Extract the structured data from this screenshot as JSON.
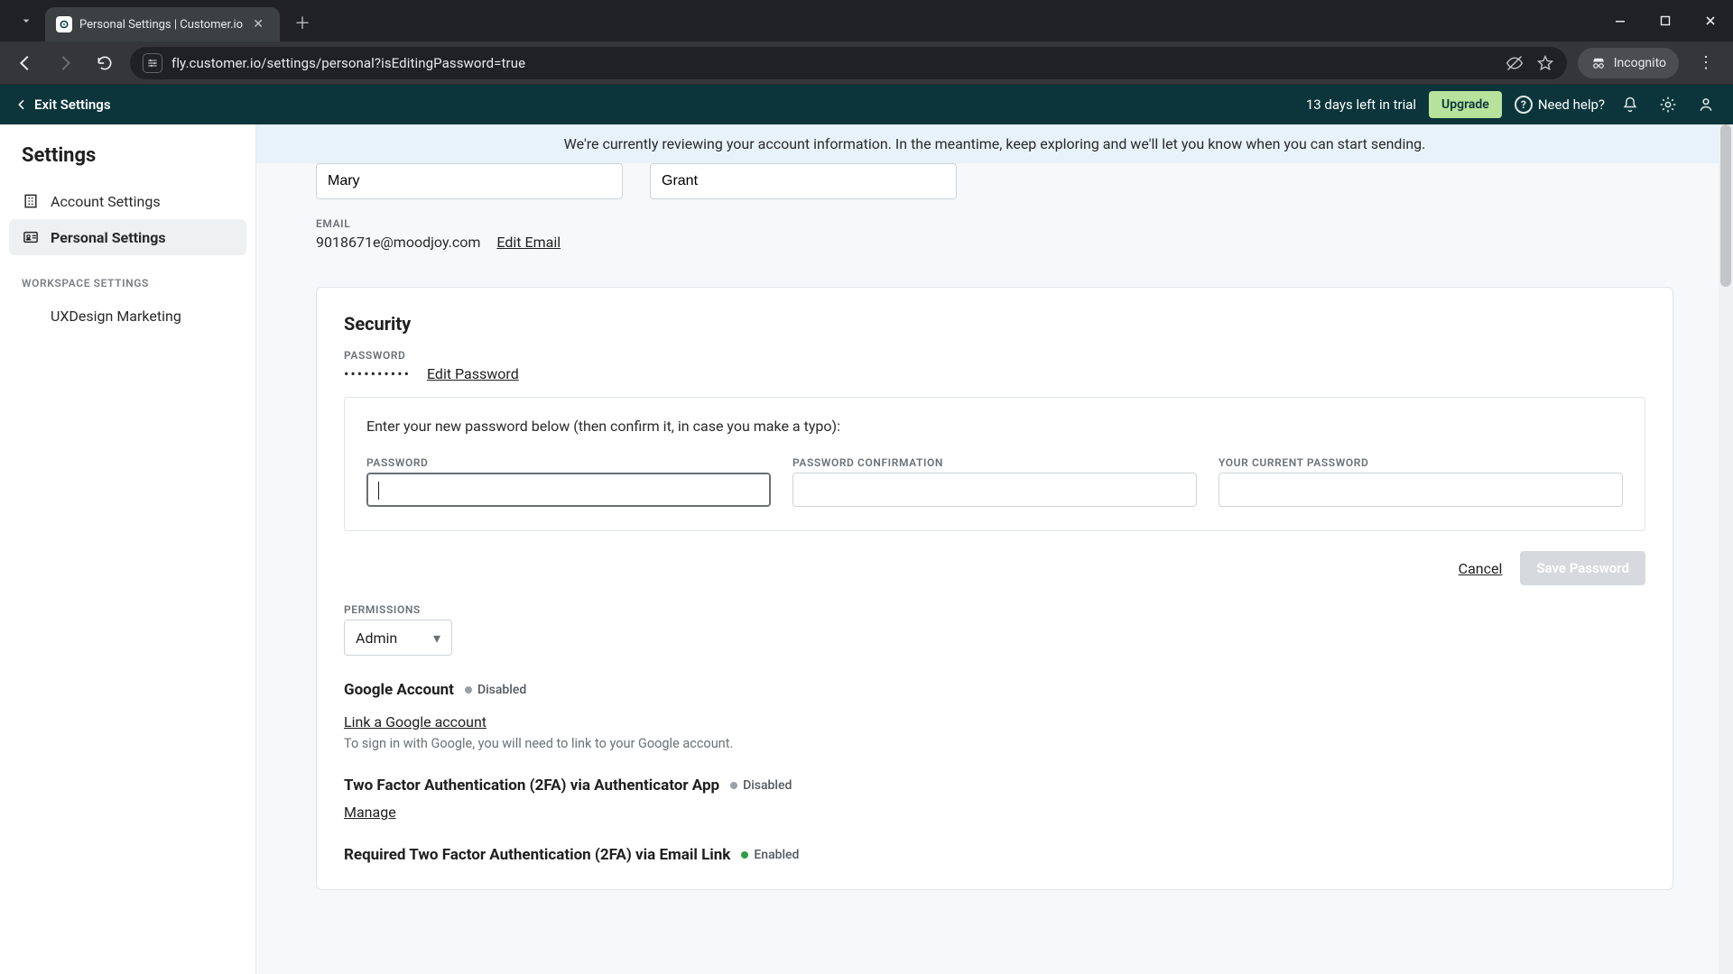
{
  "browser": {
    "tab_title": "Personal Settings | Customer.io",
    "url": "fly.customer.io/settings/personal?isEditingPassword=true",
    "incognito_label": "Incognito"
  },
  "appbar": {
    "exit_label": "Exit Settings",
    "trial_text": "13 days left in trial",
    "upgrade_label": "Upgrade",
    "help_label": "Need help?"
  },
  "sidebar": {
    "title": "Settings",
    "items": [
      {
        "label": "Account Settings"
      },
      {
        "label": "Personal Settings"
      }
    ],
    "workspace_heading": "WORKSPACE SETTINGS",
    "workspace_items": [
      {
        "label": "UXDesign Marketing"
      }
    ]
  },
  "banner": "We're currently reviewing your account information. In the meantime, keep exploring and we'll let you know when you can start sending.",
  "profile": {
    "first_name": "Mary",
    "last_name": "Grant",
    "email_label": "EMAIL",
    "email": "9018671e@moodjoy.com",
    "edit_email": "Edit Email"
  },
  "security": {
    "heading": "Security",
    "password_label": "PASSWORD",
    "password_mask": "••••••••••",
    "edit_password": "Edit Password",
    "editor": {
      "instruction": "Enter your new password below (then confirm it, in case you make a typo):",
      "new_label": "PASSWORD",
      "confirm_label": "PASSWORD CONFIRMATION",
      "current_label": "YOUR CURRENT PASSWORD",
      "cancel": "Cancel",
      "save": "Save Password"
    },
    "permissions_label": "PERMISSIONS",
    "permissions_value": "Admin",
    "google": {
      "heading": "Google Account",
      "status": "Disabled",
      "link": "Link a Google account",
      "hint": "To sign in with Google, you will need to link to your Google account."
    },
    "twofa_app": {
      "heading": "Two Factor Authentication (2FA) via Authenticator App",
      "status": "Disabled",
      "manage": "Manage"
    },
    "twofa_email": {
      "heading": "Required Two Factor Authentication (2FA) via Email Link",
      "status": "Enabled"
    }
  }
}
